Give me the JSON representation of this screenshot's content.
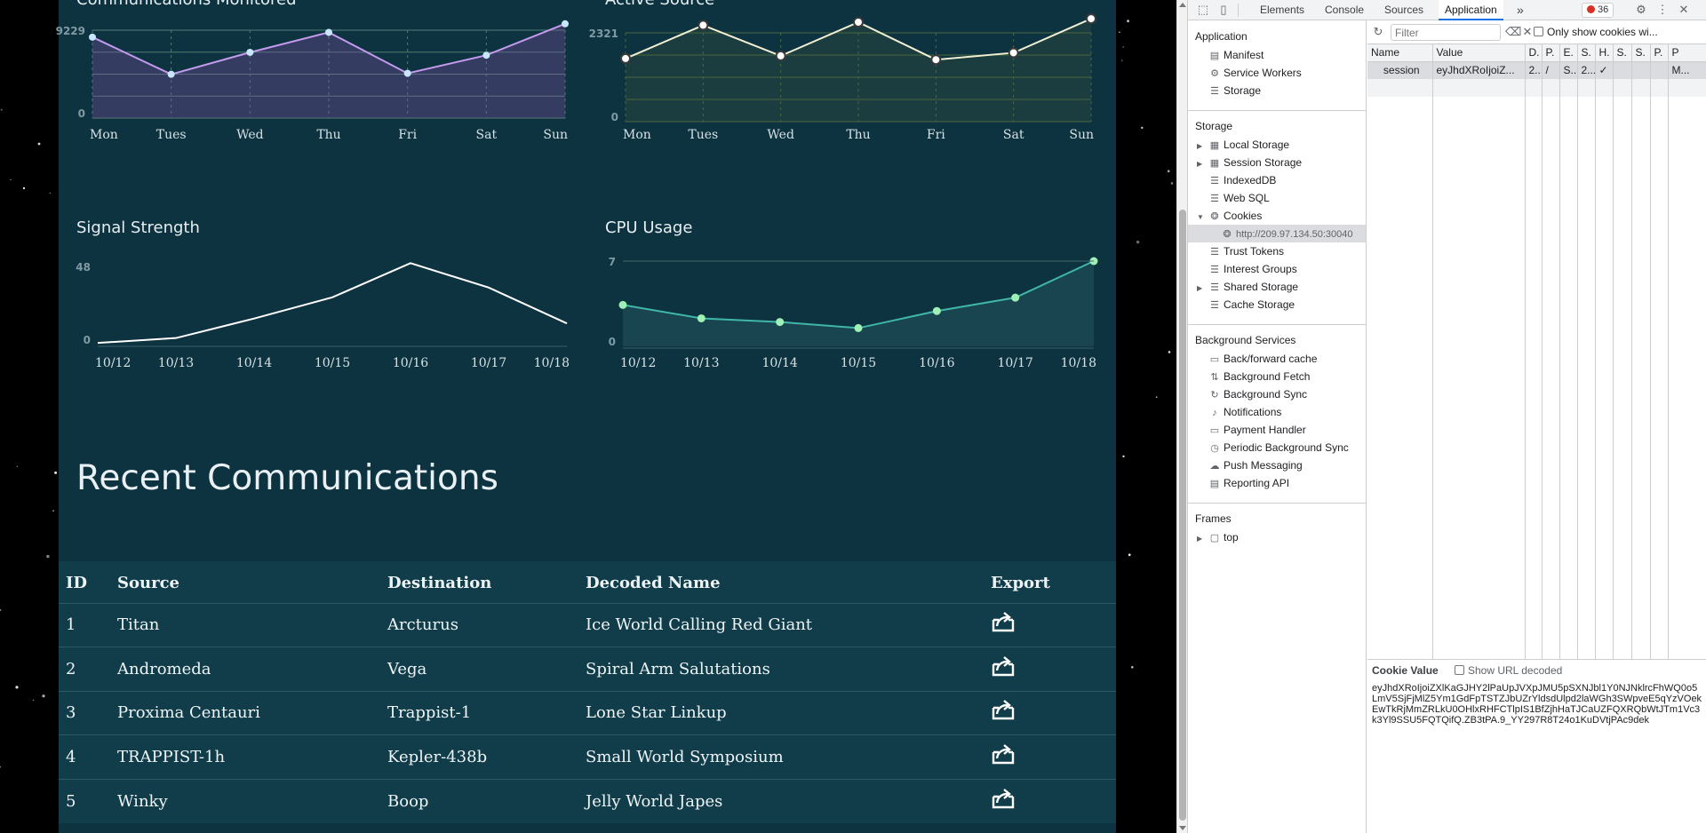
{
  "charts": {
    "communications": {
      "title": "Communications Monitored",
      "chart_data": {
        "type": "area",
        "categories": [
          "Mon",
          "Tues",
          "Wed",
          "Thu",
          "Fri",
          "Sat",
          "Sun"
        ],
        "values": [
          8500,
          4600,
          6900,
          9000,
          4700,
          6600,
          9900
        ],
        "ylim": [
          0,
          9229
        ],
        "yticks": [
          "9229",
          "0"
        ],
        "color": "#c59aef"
      }
    },
    "active_source": {
      "title": "Active Source",
      "chart_data": {
        "type": "area",
        "categories": [
          "Mon",
          "Tues",
          "Wed",
          "Thu",
          "Fri",
          "Sat",
          "Sun"
        ],
        "values": [
          1650,
          2520,
          1720,
          2600,
          1620,
          1800,
          2690
        ],
        "ylim": [
          0,
          2321
        ],
        "yticks": [
          "2321",
          "0"
        ],
        "color": "#f2efd3"
      }
    },
    "signal_strength": {
      "title": "Signal Strength",
      "chart_data": {
        "type": "line",
        "categories": [
          "10/12",
          "10/13",
          "10/14",
          "10/15",
          "10/16",
          "10/17",
          "10/18"
        ],
        "values": [
          1,
          4,
          16,
          29,
          50,
          35,
          13
        ],
        "ylim": [
          0,
          48
        ],
        "yticks": [
          "48",
          "0"
        ],
        "color": "#ffffff"
      }
    },
    "cpu_usage": {
      "title": "CPU Usage",
      "chart_data": {
        "type": "area",
        "categories": [
          "10/12",
          "10/13",
          "10/14",
          "10/15",
          "10/16",
          "10/17",
          "10/18"
        ],
        "values": [
          3.4,
          2.3,
          2.0,
          1.5,
          2.9,
          4.0,
          7.0
        ],
        "ylim": [
          0,
          7
        ],
        "yticks": [
          "7",
          "0"
        ],
        "color": "#3fb6a8"
      }
    }
  },
  "recent": {
    "title": "Recent Communications",
    "columns": [
      "ID",
      "Source",
      "Destination",
      "Decoded Name",
      "Export"
    ],
    "rows": [
      [
        "1",
        "Titan",
        "Arcturus",
        "Ice World Calling Red Giant"
      ],
      [
        "2",
        "Andromeda",
        "Vega",
        "Spiral Arm Salutations"
      ],
      [
        "3",
        "Proxima Centauri",
        "Trappist-1",
        "Lone Star Linkup"
      ],
      [
        "4",
        "TRAPPIST-1h",
        "Kepler-438b",
        "Small World Symposium"
      ],
      [
        "5",
        "Winky",
        "Boop",
        "Jelly World Japes"
      ]
    ]
  },
  "devtools": {
    "tabs": [
      "Elements",
      "Console",
      "Sources",
      "Application"
    ],
    "more": "»",
    "error_count": "36",
    "sidebar": {
      "application_head": "Application",
      "application_items": [
        "Manifest",
        "Service Workers",
        "Storage"
      ],
      "storage_head": "Storage",
      "storage_items": [
        "Local Storage",
        "Session Storage",
        "IndexedDB",
        "Web SQL",
        "Cookies"
      ],
      "cookie_origin": "http://209.97.134.50:30040",
      "storage_items_2": [
        "Trust Tokens",
        "Interest Groups",
        "Shared Storage",
        "Cache Storage"
      ],
      "background_head": "Background Services",
      "background_items": [
        "Back/forward cache",
        "Background Fetch",
        "Background Sync",
        "Notifications",
        "Payment Handler",
        "Periodic Background Sync",
        "Push Messaging",
        "Reporting API"
      ],
      "frames_head": "Frames",
      "frames_items": [
        "top"
      ]
    },
    "filter_placeholder": "Filter",
    "only_cookies_label": "Only show cookies wi...",
    "grid_columns": [
      "Name",
      "Value",
      "D.",
      "P.",
      "E.",
      "S.",
      "H.",
      "S.",
      "S.",
      "P.",
      "P"
    ],
    "cookie_row": [
      "session",
      "eyJhdXRoIjoiZ...",
      "2...",
      "/",
      "S...",
      "2...",
      "✓",
      "",
      "",
      "",
      "M..."
    ],
    "cookie_value_title": "Cookie Value",
    "show_url_decoded": "Show URL decoded",
    "cookie_value": "eyJhdXRoIjoiZXlKaGJHY2lPaUpJVXpJMU5pSXNJbl1Y0NJNklrcFhWQ0o5LmV5SjFjMlZ5Ym1GdFpTSTZJbUZrYldsdUlpd2laWGh3SWpveE5qYzVOekEwTkRjMmZRLkU0OHlxRHFCTlpIS1BfZjhHaTJCaUZFQXRQbWtJTm1Vc3k3Yl9SSU5FQTQifQ.ZB3tPA.9_YY297R8T24o1KuDVtjPAc9dek"
  }
}
